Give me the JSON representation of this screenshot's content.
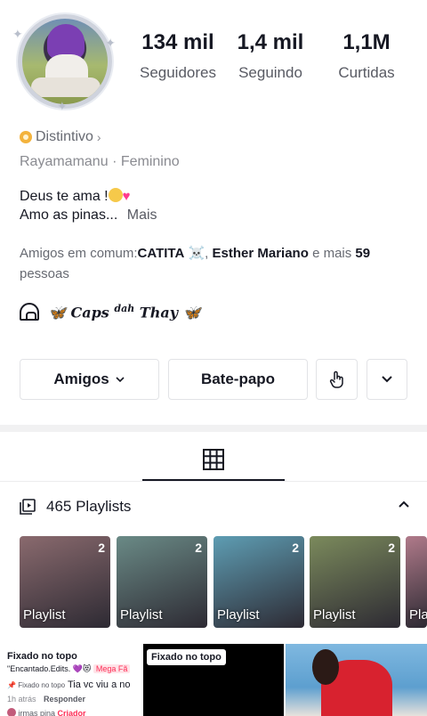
{
  "profile": {
    "stats": [
      {
        "value": "134 mil",
        "label": "Seguidores"
      },
      {
        "value": "1,4 mil",
        "label": "Seguindo"
      },
      {
        "value": "1,1M",
        "label": "Curtidas"
      }
    ],
    "badge_label": "Distintivo",
    "username": "Rayamamanu",
    "gender": "Feminino",
    "bio_line1": "Deus te ama !",
    "bio_line2": "Amo as pinas...",
    "bio_more": "Mais",
    "friends_prefix": "Amigos em comum:",
    "friend1": "CATITA",
    "friend2": "Esther Mariano",
    "friends_and": "e mais",
    "friends_count": "59",
    "friends_suffix": "pessoas",
    "caps_text": "Caps",
    "caps_sup": "dah",
    "caps_name": "Thay"
  },
  "actions": {
    "friends_button": "Amigos",
    "chat_button": "Bate-papo"
  },
  "playlists": {
    "header": "465 Playlists",
    "items": [
      {
        "label": "Playlist",
        "count": "2",
        "color": "#8a6a6e"
      },
      {
        "label": "Playlist",
        "count": "2",
        "color": "#6a8a86"
      },
      {
        "label": "Playlist",
        "count": "2",
        "color": "#5e9db3"
      },
      {
        "label": "Playlist",
        "count": "2",
        "color": "#7b8a5c"
      },
      {
        "label": "Pla",
        "count": "",
        "color": "#b07a8a"
      }
    ]
  },
  "videos": {
    "pinned_label": "Fixado no topo",
    "v1_text": "\"Encantado.Edits. 💜😻",
    "v1_tag": "Mega Fã",
    "v1_pin": "Fixado no topo",
    "v1_line": "Tia vc viu a no",
    "v1_time": "1h atrás",
    "v1_reply": "Responder",
    "v1_bottom": "irmas pina",
    "v1_creator": "Criador"
  }
}
